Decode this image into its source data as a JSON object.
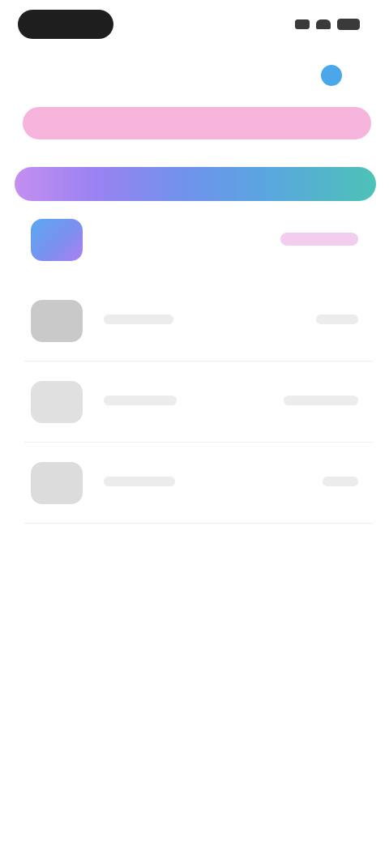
{
  "header": {
    "title": "",
    "action_label": ""
  },
  "banner": {
    "text": ""
  },
  "promo_bar": {
    "text": ""
  },
  "list": {
    "items": [
      {
        "name": "",
        "meta": ""
      },
      {
        "name": "",
        "meta": ""
      },
      {
        "name": "",
        "meta": ""
      },
      {
        "name": "",
        "meta": ""
      }
    ]
  },
  "colors": {
    "status_pill": "#1e1e1e",
    "action_accent": "#4aa8ea",
    "banner_pink": "#f6b3dc",
    "promo_gradient_start": "#c48ff0",
    "promo_gradient_mid": "#6f93ec",
    "promo_gradient_end": "#4dc2b6",
    "active_thumb": "#5aa8f0",
    "active_meta": "#e8a6e2"
  },
  "icons": {
    "signal": "signal-icon",
    "wifi": "wifi-icon",
    "battery": "battery-icon",
    "action": "info-icon"
  }
}
